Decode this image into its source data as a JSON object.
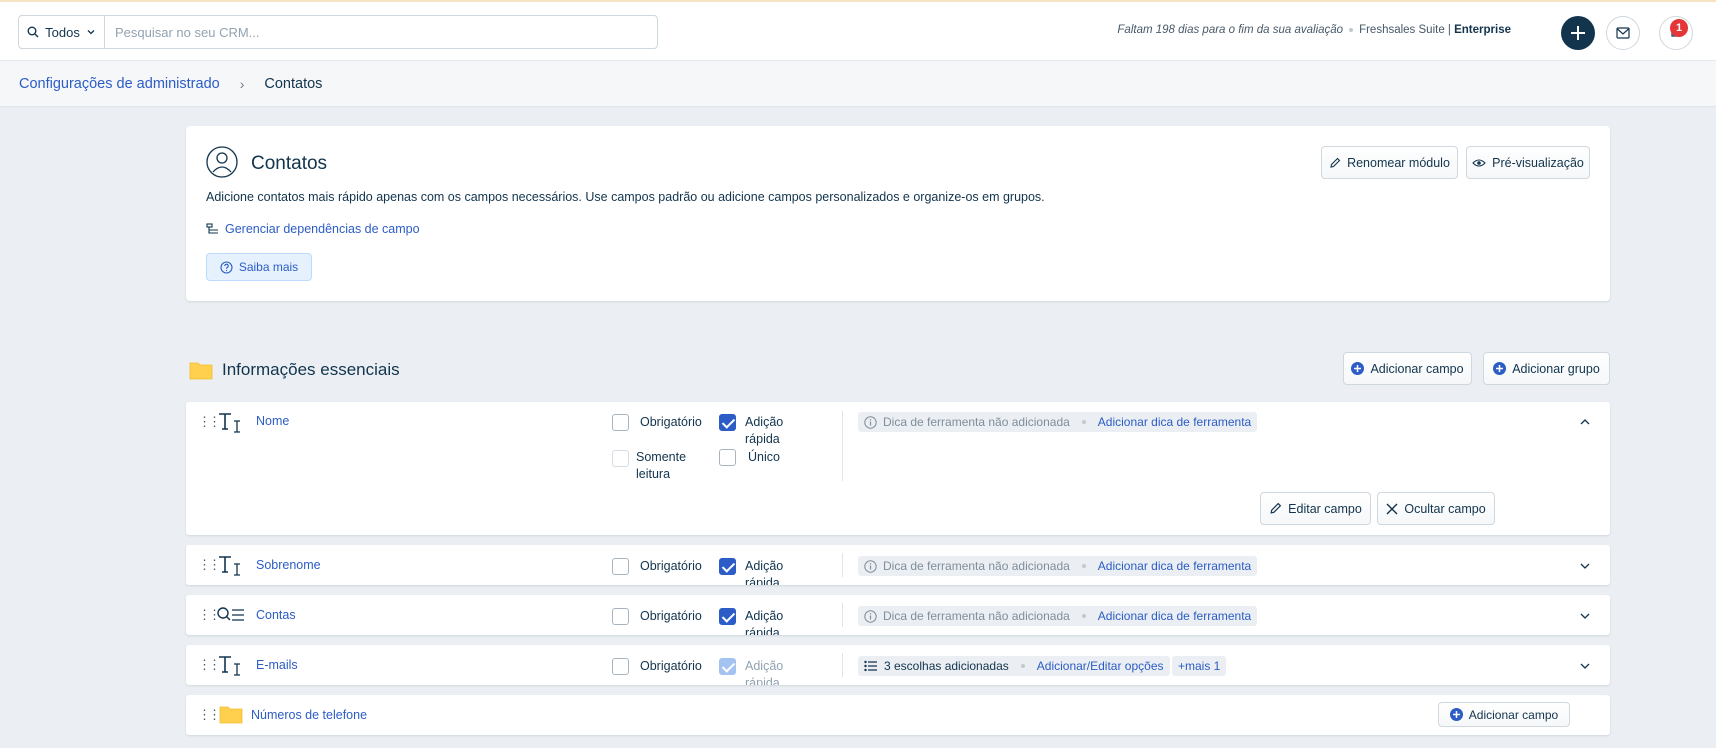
{
  "topbar": {
    "search_scope": "Todos",
    "search_placeholder": "Pesquisar no seu CRM...",
    "trial_text": "Faltam 198 dias para o fim da sua avaliação",
    "product": "Freshsales Suite |",
    "plan": "Enterprise",
    "notification_count": "1"
  },
  "breadcrumb": {
    "parent": "Configurações de administrado",
    "separator": "›",
    "current": "Contatos"
  },
  "module": {
    "title": "Contatos",
    "description": "Adicione contatos mais rápido apenas com os campos necessários. Use campos padrão ou adicione campos personalizados e organize-os em grupos.",
    "dependencies_link": "Gerenciar dependências de campo",
    "learn_more": "Saiba mais",
    "rename_button": "Renomear módulo",
    "preview_button": "Pré-visualização"
  },
  "section": {
    "title": "Informações essenciais",
    "add_field": "Adicionar campo",
    "add_group": "Adicionar grupo"
  },
  "labels": {
    "required": "Obrigatório",
    "quick_add_1": "Adição",
    "quick_add_2": "rápida",
    "read_only_1": "Somente",
    "read_only_2": "leitura",
    "unique": "Único",
    "tip_none": "Dica de ferramenta não adicionada",
    "tip_add": "Adicionar dica de ferramenta",
    "edit_field": "Editar campo",
    "hide_field": "Ocultar campo"
  },
  "fields": [
    {
      "name": "Nome",
      "icon": "text-field-icon",
      "required": false,
      "quick_add": true
    },
    {
      "name": "Sobrenome",
      "icon": "text-field-icon",
      "required": false,
      "quick_add": true
    },
    {
      "name": "Contas",
      "icon": "lookup-field-icon",
      "required": false,
      "quick_add": true
    },
    {
      "name": "E-mails",
      "icon": "text-field-icon",
      "required": false,
      "quick_add": true,
      "choices": "3 escolhas adicionadas",
      "choices_link": "Adicionar/Editar opções",
      "more": "+mais 1"
    }
  ],
  "subgroup": {
    "name": "Números de telefone",
    "add_field": "Adicionar campo"
  },
  "colors": {
    "accent": "#2c5cc5",
    "navy": "#12344d",
    "badge": "#e43538",
    "folder": "#ffd04d"
  }
}
